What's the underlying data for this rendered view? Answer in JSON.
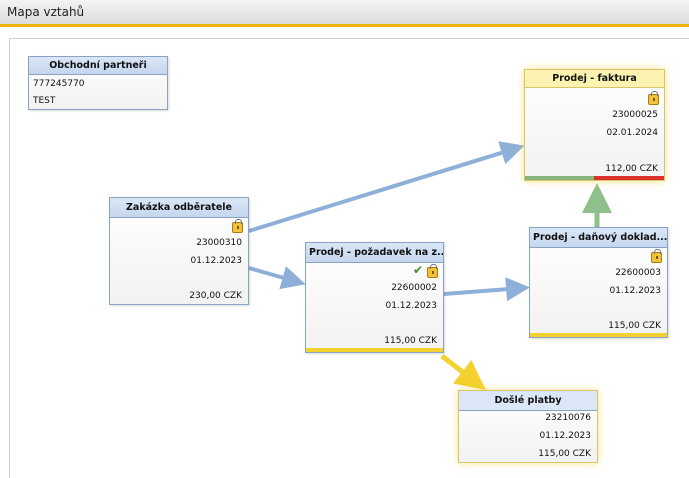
{
  "window": {
    "title": "Mapa vztahů"
  },
  "partner": {
    "header": "Obchodní partneři",
    "code": "777245770",
    "name": "TEST"
  },
  "nodes": {
    "zakazka": {
      "header": "Zakázka odběratele",
      "number": "23000310",
      "date": "01.12.2023",
      "amount": "230,00 CZK"
    },
    "pozadavek": {
      "header": "Prodej - požadavek na z...",
      "number": "22600002",
      "date": "01.12.2023",
      "amount": "115,00 CZK"
    },
    "danovy": {
      "header": "Prodej - daňový doklad...",
      "number": "22600003",
      "date": "01.12.2023",
      "amount": "115,00 CZK"
    },
    "faktura": {
      "header": "Prodej - faktura",
      "number": "23000025",
      "date": "02.01.2024",
      "amount": "112,00 CZK"
    },
    "platby": {
      "header": "Došlé platby",
      "number": "23210076",
      "date": "01.12.2023",
      "amount": "115,00 CZK"
    }
  },
  "colors": {
    "link_blue": "#8eb0d8",
    "link_green": "#8fbf8a",
    "link_yellow": "#f3d12e",
    "status_yellow": "#f3d12e",
    "status_green": "#88b57c",
    "status_red": "#d8322a"
  },
  "icons": {
    "lock": "padlock-icon",
    "approve": "approved-check-icon"
  }
}
